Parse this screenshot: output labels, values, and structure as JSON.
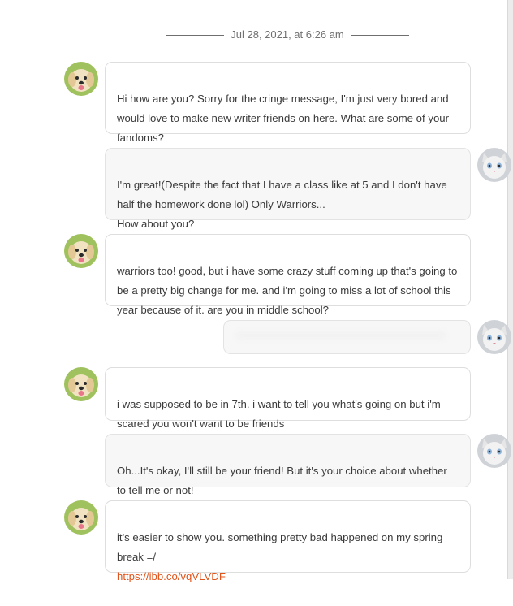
{
  "conversation": {
    "date_divider": "Jul 28, 2021, at 6:26 am",
    "messages": [
      {
        "sender": "other",
        "avatar_icon": "dog-avatar-icon",
        "text": "Hi how are you? Sorry for the cringe message, I'm just very bored and\nwould love to make new writer friends on here. What are some of your\nfandoms?"
      },
      {
        "sender": "self",
        "avatar_icon": "cat-avatar-icon",
        "text": "I'm great!(Despite the fact that I have a class like at 5 and I don't have\nhalf the homework done lol) Only Warriors...\nHow about you?"
      },
      {
        "sender": "other",
        "avatar_icon": "dog-avatar-icon",
        "text": "warriors too! good, but i have some crazy stuff coming up that's going to\nbe a pretty big change for me. and i'm going to miss a lot of school this\nyear because of it. are you in middle school?"
      },
      {
        "sender": "self",
        "avatar_icon": "cat-avatar-icon",
        "text": ""
      },
      {
        "sender": "other",
        "avatar_icon": "dog-avatar-icon",
        "text": "i was supposed to be in 7th. i want to tell you what's going on but i'm\nscared you won't want to be friends"
      },
      {
        "sender": "self",
        "avatar_icon": "cat-avatar-icon",
        "text": "Oh...It's okay, I'll still be your friend! But it's your choice about whether\nto tell me or not!"
      },
      {
        "sender": "other",
        "avatar_icon": "dog-avatar-icon",
        "text": "it's easier to show you. something pretty bad happened on my spring\nbreak =/",
        "link": "https://ibb.co/vqVLVDF"
      }
    ]
  },
  "colors": {
    "link": "#e1541b",
    "bubble_border": "#dedede",
    "self_bubble_bg": "#f7f7f7",
    "text": "#3a3a3a"
  }
}
